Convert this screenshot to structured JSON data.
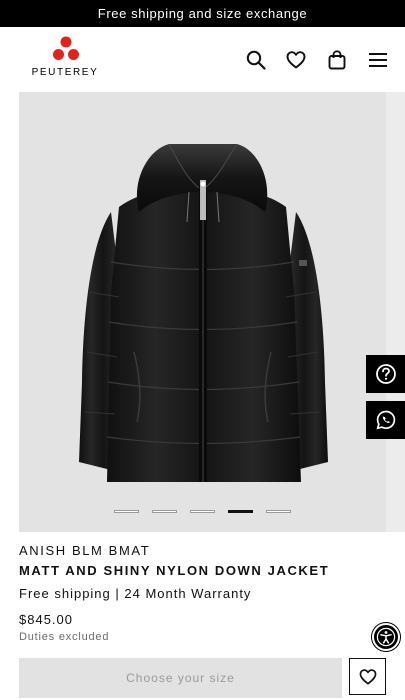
{
  "promo": {
    "text": "Free shipping and size exchange"
  },
  "header": {
    "logo_text": "PEUTEREY",
    "icons": [
      "search-icon",
      "heart-icon",
      "shopping-bag-icon",
      "menu-icon"
    ]
  },
  "gallery": {
    "image": "black-down-jacket",
    "slide_count": 5,
    "active_slide": 4
  },
  "product": {
    "brand_line": "ANISH BLM BMAT",
    "name": "MATT AND SHINY NYLON DOWN JACKET",
    "shipping": "Free shipping | 24 Month Warranty",
    "price": "$845.00",
    "duties": "Duties excluded"
  },
  "actions": {
    "choose_size_label": "Choose your size",
    "wishlist_icon": "heart-icon"
  },
  "side_buttons": [
    "help-icon",
    "whatsapp-icon"
  ],
  "accessibility_icon": "accessibility-icon",
  "colors": {
    "promo_bg": "#000000",
    "brand_red": "#e2231a",
    "gallery_bg": "#e3e3e3",
    "size_button_bg": "#e2e2e2"
  }
}
